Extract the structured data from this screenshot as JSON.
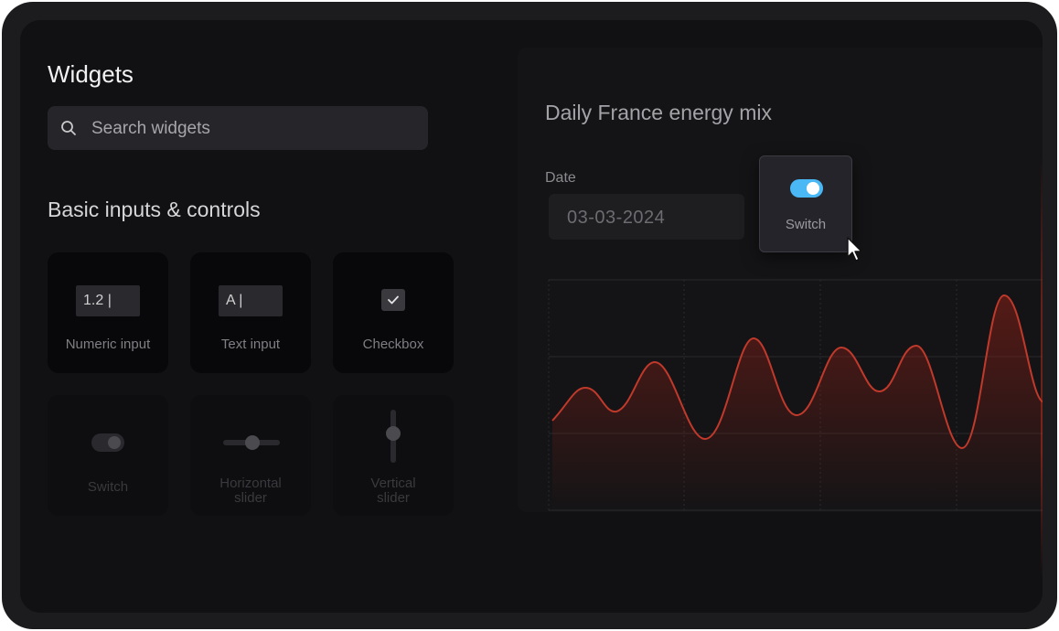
{
  "sidebar": {
    "title": "Widgets",
    "search_placeholder": "Search widgets",
    "section_title": "Basic inputs & controls",
    "widgets": [
      {
        "label": "Numeric input",
        "preview": "1.2 |"
      },
      {
        "label": "Text input",
        "preview": "A |"
      },
      {
        "label": "Checkbox"
      },
      {
        "label": "Switch"
      },
      {
        "label": "Horizontal\nslider"
      },
      {
        "label": "Vertical\nslider"
      }
    ]
  },
  "panel": {
    "title": "Daily France energy mix",
    "date_label": "Date",
    "date_value": "03-03-2024"
  },
  "drag_preview": {
    "label": "Switch",
    "toggle_on": true,
    "toggle_color": "#4bb8f6"
  },
  "colors": {
    "accent": "#4bb8f6",
    "series": "#c0392b"
  },
  "icons": {
    "search": "search-icon",
    "checkbox": "check-icon",
    "cursor": "cursor-icon"
  }
}
